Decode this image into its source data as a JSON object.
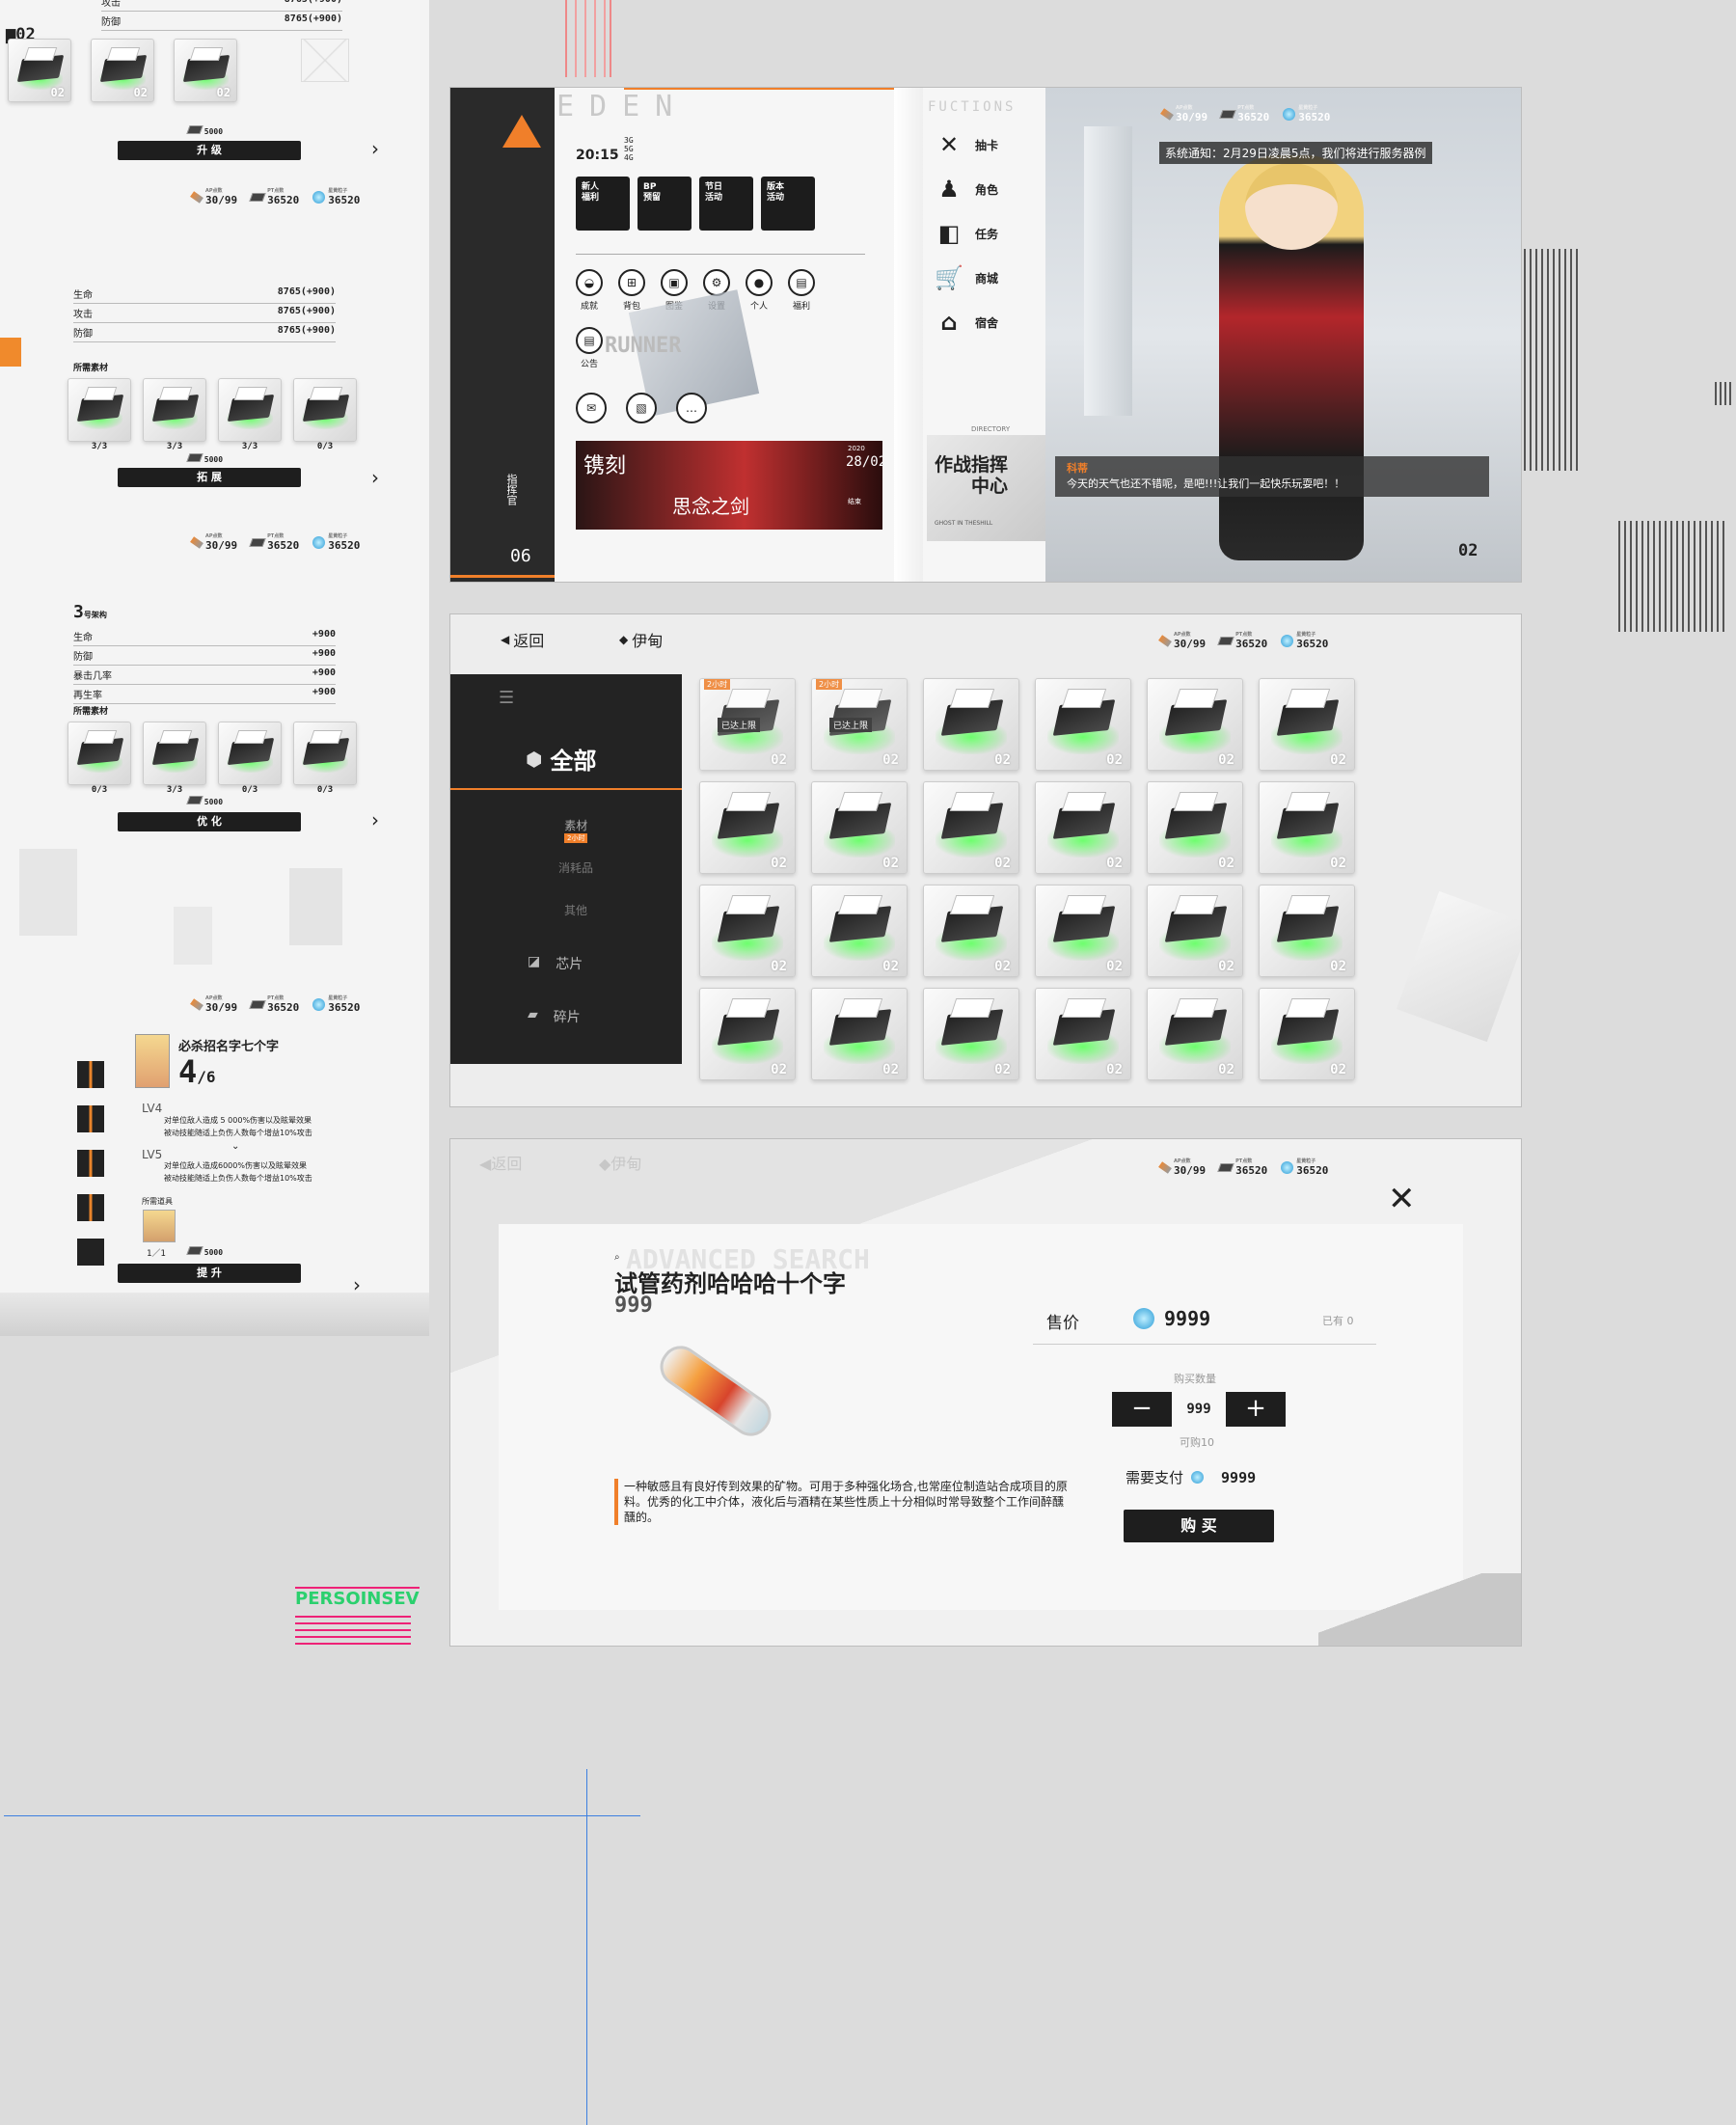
{
  "resources": {
    "ap_label": "AP点数",
    "ap": "30/99",
    "pt_label": "PT点数",
    "pt": "36520",
    "gem_label": "星黄粒子",
    "gem": "36520"
  },
  "left": {
    "header_tag": "02",
    "top_stats": [
      {
        "label": "攻击",
        "value": "8765(+900)"
      },
      {
        "label": "防御",
        "value": "8765(+900)"
      }
    ],
    "tile_tag": "02",
    "cost1": "5000",
    "btn1": "升 级",
    "stats2": [
      {
        "label": "生命",
        "value": "8765(+900)"
      },
      {
        "label": "攻击",
        "value": "8765(+900)"
      },
      {
        "label": "防御",
        "value": "8765(+900)"
      }
    ],
    "materials_label": "所需素材",
    "qty2": [
      "3/3",
      "3/3",
      "3/3",
      "0/3"
    ],
    "cost2": "5000",
    "btn2": "拓 展",
    "section3_title": "3",
    "section3_sub": "号架构",
    "stats3": [
      {
        "label": "生命",
        "value": "+900"
      },
      {
        "label": "防御",
        "value": "+900"
      },
      {
        "label": "暴击几率",
        "value": "+900"
      },
      {
        "label": "再生率",
        "value": "+900"
      }
    ],
    "qty3": [
      "0/3",
      "3/3",
      "0/3",
      "0/3"
    ],
    "cost3": "5000",
    "btn3": "优 化",
    "skill_name": "必杀招名字七个字",
    "skill_level": "4",
    "skill_max": "/6",
    "lv4": "LV4",
    "lv4_desc1": "对单位敌人造成 5 000%伤害以及眩晕效果",
    "lv4_desc2": "被动技能随适上负伤人数每个增益10%攻击",
    "lv5": "LV5",
    "lv5_desc1": "对单位敌人造成6000%伤害以及眩晕效果",
    "lv5_desc2": "被动技能随适上负伤人数每个增益10%攻击",
    "need_item": "所需道具",
    "item_qty": "1／1",
    "cost4": "5000",
    "btn4": "提 升",
    "persoin": "PERSOINSEV"
  },
  "home": {
    "eden": "EDEN",
    "time": "20:15",
    "signals": [
      "3G",
      "5G",
      "4G"
    ],
    "vertical_label": "指挥官",
    "vertical_num": "06",
    "menu": [
      {
        "label": "新人\n福利"
      },
      {
        "label": "BP\n预留"
      },
      {
        "label": "节日\n活动"
      },
      {
        "label": "版本\n活动"
      }
    ],
    "circles": [
      {
        "label": "成就",
        "icon": "◒"
      },
      {
        "label": "背包",
        "icon": "⊞"
      },
      {
        "label": "图鉴",
        "icon": "▣"
      },
      {
        "label": "设置",
        "icon": "⚙"
      },
      {
        "label": "个人",
        "icon": "●"
      },
      {
        "label": "福利",
        "icon": "▤"
      }
    ],
    "notice_label": "公告",
    "runner": "RUNNER",
    "banner_title": "镌刻",
    "banner_sub": "思念之剑",
    "banner_date_year": "2020",
    "banner_date": "28/02",
    "banner_end": "结束",
    "actions": [
      {
        "label": "抽卡",
        "icon": "✕"
      },
      {
        "label": "角色",
        "icon": "♟"
      },
      {
        "label": "任务",
        "icon": "◧"
      },
      {
        "label": "商城",
        "icon": "🛒"
      },
      {
        "label": "宿舍",
        "icon": "⌂"
      }
    ],
    "functions": "FUCTIONS",
    "directory": "DIRECTORY",
    "command_center": "作战指挥\n中心",
    "ghost": "GHOST IN THESHILL",
    "system_notice": "系统通知：2月29日凌晨5点，我们将进行服务器例",
    "speaker": "科蒂",
    "dialogue": "今天的天气也还不错呢，是吧!!!让我们一起快乐玩耍吧！！",
    "char_tag": "02"
  },
  "bag": {
    "back": "返回",
    "char": "伊甸",
    "all": "全部",
    "sub_material": "素材",
    "sub_badge": "2小时",
    "sub_consume": "消耗品",
    "sub_other": "其他",
    "chip": "芯片",
    "fragment": "碎片",
    "timer": "2小时",
    "limit": "已达上限",
    "tag": "02"
  },
  "shop": {
    "back": "返回",
    "char": "伊甸",
    "bg_word": "ADVANCED SEARCH",
    "item_name": "试管药剂哈哈哈十个字",
    "item_count": "999",
    "price_label": "售价",
    "price": "9999",
    "owned": "已有 0",
    "buy_qty_label": "购买数量",
    "qty": "999",
    "can_buy": "可购10",
    "pay_label": "需要支付",
    "pay": "9999",
    "buy_btn": "购 买",
    "desc": "一种敏感且有良好传到效果的矿物。可用于多种强化场合,也常座位制造站合成项目的原料。优秀的化工中介体，液化后与酒精在某些性质上十分相似时常导致整个工作间醉醺醺的。",
    "minus": "−",
    "plus": "+"
  }
}
